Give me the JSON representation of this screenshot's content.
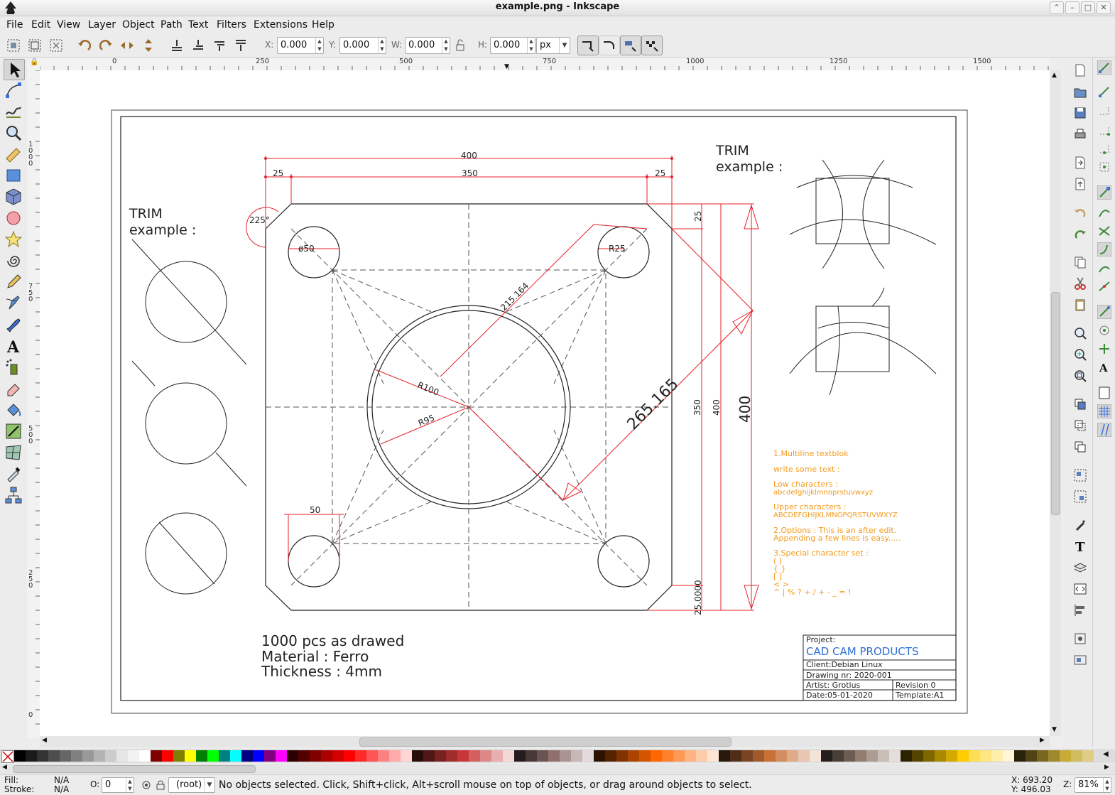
{
  "window": {
    "title": "example.png - Inkscape"
  },
  "menu": [
    "File",
    "Edit",
    "View",
    "Layer",
    "Object",
    "Path",
    "Text",
    "Filters",
    "Extensions",
    "Help"
  ],
  "toolbar": {
    "x_label": "X:",
    "x_value": "0.000",
    "y_label": "Y:",
    "y_value": "0.000",
    "w_label": "W:",
    "w_value": "0.000",
    "h_label": "H:",
    "h_value": "0.000",
    "unit": "px"
  },
  "ruler": {
    "h_ticks": [
      "0",
      "250",
      "500",
      "750",
      "1000",
      "1250",
      "1500"
    ],
    "v_ticks": [
      "1000",
      "750",
      "500",
      "250",
      "0"
    ]
  },
  "drawing": {
    "dims": {
      "top_total": "400",
      "left_margin": "25",
      "middle": "350",
      "right_margin": "25",
      "angle": "225°",
      "hole_dia": "ø50",
      "radius_small": "R25",
      "diag1": "215.164",
      "r100": "R100",
      "r95": "R95",
      "diag2": "265.165",
      "hole_offset": "50",
      "side_25": "25",
      "side_350": "350",
      "side_400": "400",
      "side_400_big": "400",
      "side_bottom": "25.0000"
    },
    "trim_left": {
      "line1": "TRIM",
      "line2": "example :"
    },
    "trim_right": {
      "line1": "TRIM",
      "line2": "example :"
    },
    "notes": {
      "line1": "1000 pcs as drawed",
      "line2": "Material : Ferro",
      "line3": "Thickness : 4mm"
    },
    "textblock": [
      "1.Multiline textblok",
      "write some text :",
      "Low characters :",
      "abcdefghijklmnoprstuvwxyz",
      "Upper characters :",
      "ABCDEFGHIJKLMNOPQRSTUVWXYZ",
      "2.Options : This is an after edit.",
      "Appending a few lines is easy.....",
      "3.Special character set :",
      "( )",
      "{ }",
      "[ ]",
      "< >",
      "^ | % ? + / + - _ = !"
    ],
    "titleblock": {
      "project_label": "Project:",
      "project": "CAD CAM PRODUCTS",
      "client": "Client:Debian Linux",
      "drawing_nr": "Drawing nr: 2020-001",
      "artist": "Artist: Grotius",
      "revision": "Revision   0",
      "date": "Date:05-01-2020",
      "template": "Template:A1"
    }
  },
  "palette": {
    "colors": [
      "#000000",
      "#1a1a1a",
      "#333333",
      "#4d4d4d",
      "#666666",
      "#808080",
      "#999999",
      "#b3b3b3",
      "#cccccc",
      "#e6e6e6",
      "#f2f2f2",
      "#ffffff",
      "#800000",
      "#ff0000",
      "#808000",
      "#ffff00",
      "#008000",
      "#00ff00",
      "#008080",
      "#00ffff",
      "#000080",
      "#0000ff",
      "#800080",
      "#ff00ff",
      "#2b0000",
      "#550000",
      "#800000",
      "#aa0000",
      "#d40000",
      "#ff0000",
      "#ff2a2a",
      "#ff5555",
      "#ff8080",
      "#ffaaaa",
      "#ffd5d5",
      "#280b0b",
      "#501616",
      "#782121",
      "#a02c2c",
      "#c83737",
      "#d35f5f",
      "#de8787",
      "#e9afaf",
      "#f4d7d7",
      "#241c1c",
      "#483737",
      "#6c5353",
      "#916f6f",
      "#ac9393",
      "#c8b7b7",
      "#e3dbdb",
      "#2b1100",
      "#552200",
      "#803300",
      "#aa4400",
      "#d45500",
      "#ff6600",
      "#ff7f2a",
      "#ff9955",
      "#ffb380",
      "#ffccaa",
      "#ffe6d5",
      "#28170b",
      "#502d16",
      "#784421",
      "#a05a2c",
      "#c87137",
      "#d38d5f",
      "#deaa87",
      "#e9c6af",
      "#f4e3d7",
      "#241f1c",
      "#483e37",
      "#6c5d53",
      "#917c6f",
      "#ac9d93",
      "#c8beb7",
      "#e3dedb",
      "#2b2200",
      "#554400",
      "#806600",
      "#aa8800",
      "#d4aa00",
      "#ffcc00",
      "#ffdd55",
      "#ffe680",
      "#ffeeaa",
      "#fff6d5",
      "#28220b",
      "#504416",
      "#786721",
      "#a0892c",
      "#c8ab37",
      "#d3bc5f",
      "#decd87"
    ]
  },
  "status": {
    "fill_label": "Fill:",
    "fill_value": "N/A",
    "stroke_label": "Stroke:",
    "stroke_value": "N/A",
    "opacity_label": "O:",
    "opacity_value": "0",
    "layer": "(root)",
    "message": "No objects selected. Click, Shift+click, Alt+scroll mouse on top of objects, or drag around objects to select.",
    "x_coord": "X:  693.20",
    "y_coord": "Y:  496.03",
    "zoom_label": "Z:",
    "zoom": "81%"
  },
  "colors": {
    "dimension": "#e8202a",
    "text_orange": "#f39a1e",
    "project_blue": "#2f6fd6"
  }
}
